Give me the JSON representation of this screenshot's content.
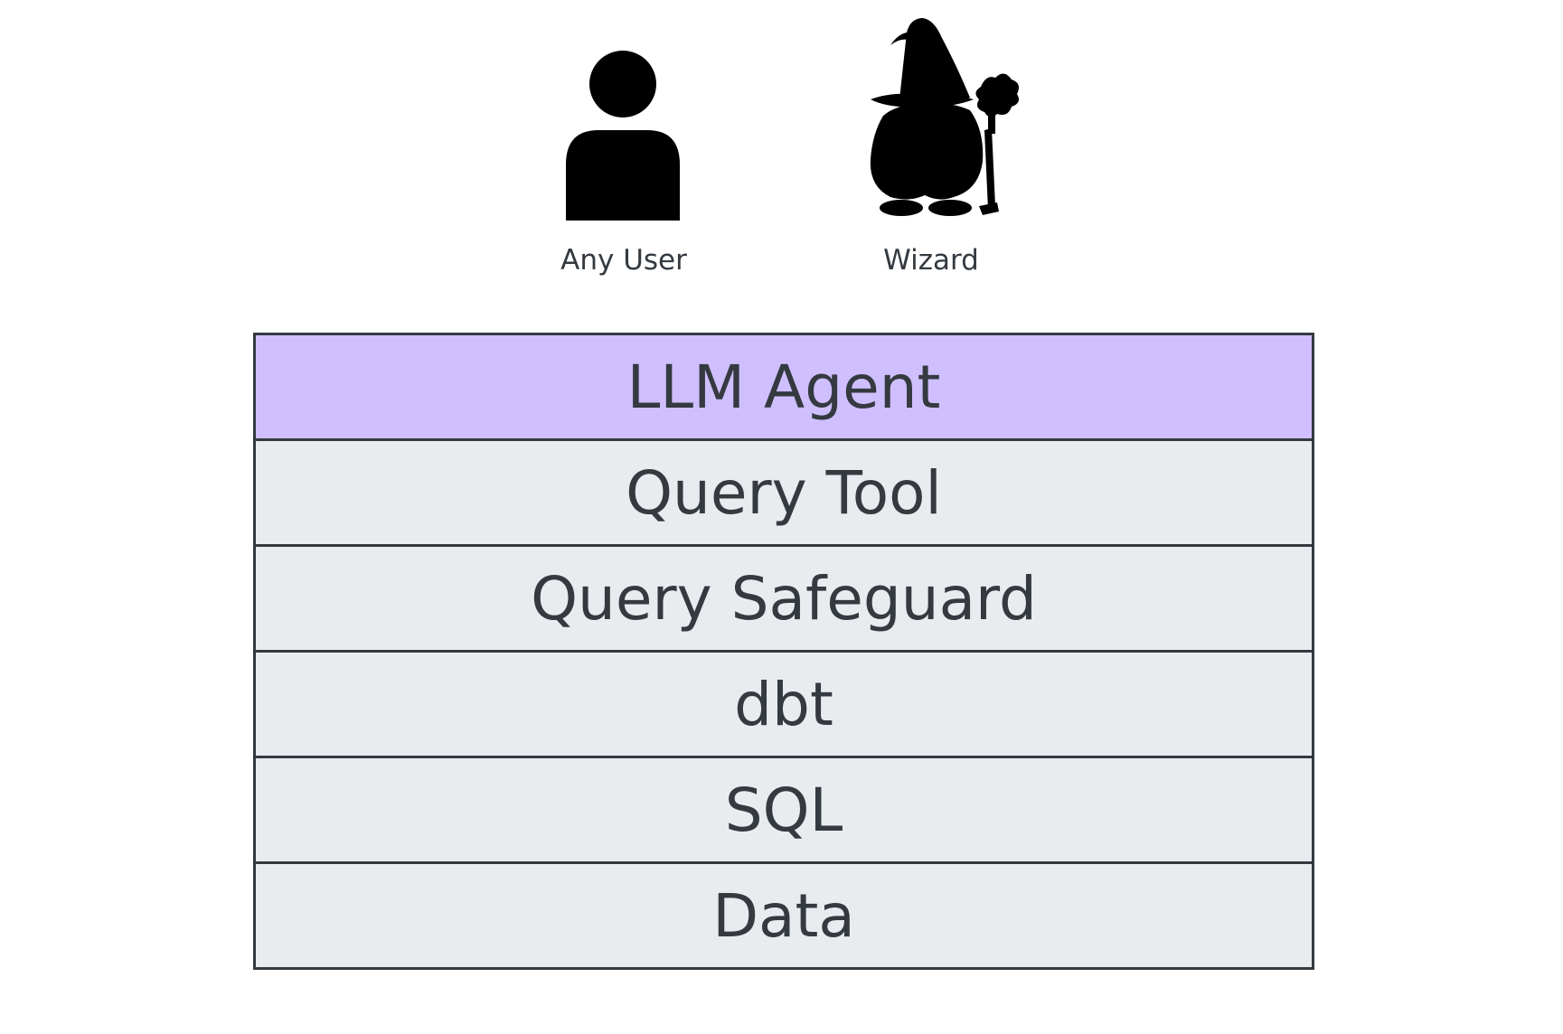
{
  "actors": [
    {
      "label": "Any User",
      "icon": "person-icon"
    },
    {
      "label": "Wizard",
      "icon": "wizard-icon"
    }
  ],
  "layers": [
    {
      "label": "LLM Agent",
      "color": "#d0bfff"
    },
    {
      "label": "Query Tool",
      "color": "#e9ecef"
    },
    {
      "label": "Query Safeguard",
      "color": "#e9ecef"
    },
    {
      "label": "dbt",
      "color": "#e9ecef"
    },
    {
      "label": "SQL",
      "color": "#e9ecef"
    },
    {
      "label": "Data",
      "color": "#e9ecef"
    }
  ],
  "colors": {
    "stroke": "#343a40",
    "layer_default": "#e9ecef",
    "layer_highlight": "#d0bfff",
    "icon": "#000000"
  }
}
